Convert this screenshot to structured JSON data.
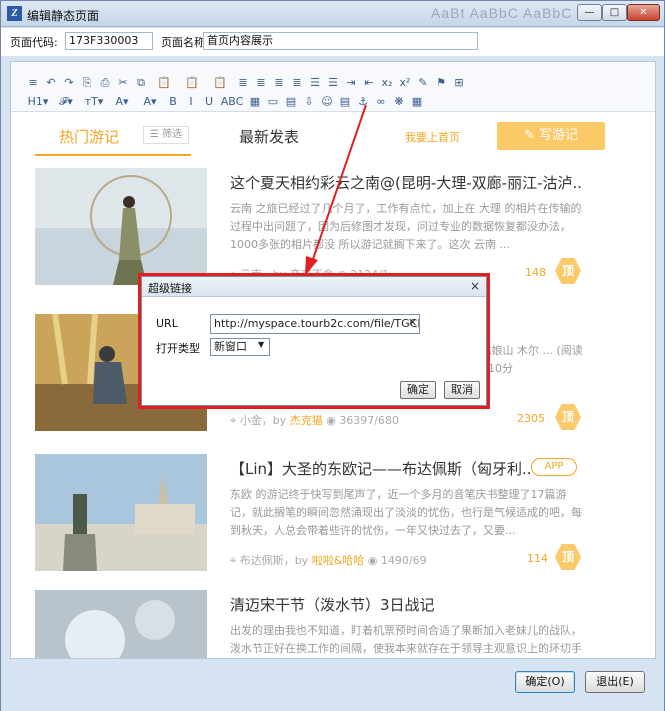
{
  "window": {
    "title": "编辑静态页面",
    "background_title": "AaBt  AaBbC  AaBbC",
    "controls": {
      "minimize": "—",
      "maximize": "□",
      "close": "✕"
    }
  },
  "meta": {
    "code_label": "页面代码:",
    "code_value": "173F330003",
    "name_label": "页面名称:",
    "name_value": "首页内容展示"
  },
  "toolbar": {
    "row1": [
      "≡",
      "↶",
      "↷",
      "⎘",
      "⎙",
      "✂",
      "⧉",
      "📋",
      "📋",
      "📋",
      "≣",
      "≣",
      "≣",
      "≣",
      "☰",
      "☰",
      "⇥",
      "⇤",
      "x₂",
      "x²",
      "✎",
      "⚑",
      "⊞"
    ],
    "row2": [
      "H1▾",
      "𝓕▾",
      "тT▾",
      "A▾",
      "A▾",
      "B",
      "I",
      "U",
      "ABC",
      "▦",
      "▭",
      "▤",
      "⇩",
      "☺",
      "▤",
      "⚓",
      "∞",
      "❋",
      "▦"
    ]
  },
  "page": {
    "tab_hot": "热门游记",
    "tab_filter": "☰ 筛选",
    "tab_new": "最新发表",
    "home_link": "我要上首页",
    "write_button": "✎ 写游记",
    "posts": [
      {
        "title": "这个夏天相约彩云之南@(昆明-大理-双廊-丽江-沽泸..",
        "body": "云南 之旅已经过了几个月了，工作有点忙，加上在 大理 的相片在传输的过程中出问题了，因为后修图才发现，问过专业的数据恢复都没办法，1000多张的相片都没 所以游记就搁下来了。这次 云南 ...",
        "meta": "云南，by 恋恋不舍",
        "stats": "2124/1",
        "likes": "148",
        "badge": "顶"
      },
      {
        "title": "",
        "body": "山 四姑娘山 木尔 ...  (阅读时间7-10分",
        "meta": "小金，by",
        "author": "杰克猫",
        "stats": "36397/680",
        "likes": "2305",
        "badge": "顶"
      },
      {
        "title": "【Lin】大圣的东欧记——布达佩斯（匈牙利..",
        "app_badge": "APP",
        "body": "东欧 的游记终于快写到尾声了，近一个多月的音笔庆书整理了17篇游记，就此搁笔的瞬间忽然涌现出了淡淡的忧伤，也行是气候适成的吧，每到秋天，人总会带着些许的忧伤，一年又快过去了，又要...",
        "meta": "布达佩斯，by",
        "author": "啦啦&哈哈",
        "stats": "1490/69",
        "likes": "114",
        "badge": "顶"
      },
      {
        "title": "清迈宋干节（泼水节）3日战记",
        "body": "出发的理由我也不知道，盯着机票预时间合适了果断加入老妹儿的战队，泼水节正好在换工作的间隔，使我本来就存在于领导主观意识上的环切手术折扬镜会外不思像预期那样在领导主观意识上摆开",
        "meta": "",
        "stats": "",
        "likes": "",
        "badge": ""
      }
    ]
  },
  "hyperlink_dialog": {
    "title": "超级链接",
    "close": "×",
    "url_label": "URL",
    "url_value": "http://myspace.tourb2c.com/file/TGCKF201:",
    "url_clear": "✕",
    "open_type_label": "打开类型",
    "open_type_value": "新窗口",
    "ok": "确定",
    "cancel": "取消"
  },
  "bottom": {
    "ok": "确定(O)",
    "exit": "退出(E)"
  },
  "colors": {
    "accent": "#f5a623",
    "highlight_box": "#e02020",
    "window_frame": "#d6e3f2"
  }
}
